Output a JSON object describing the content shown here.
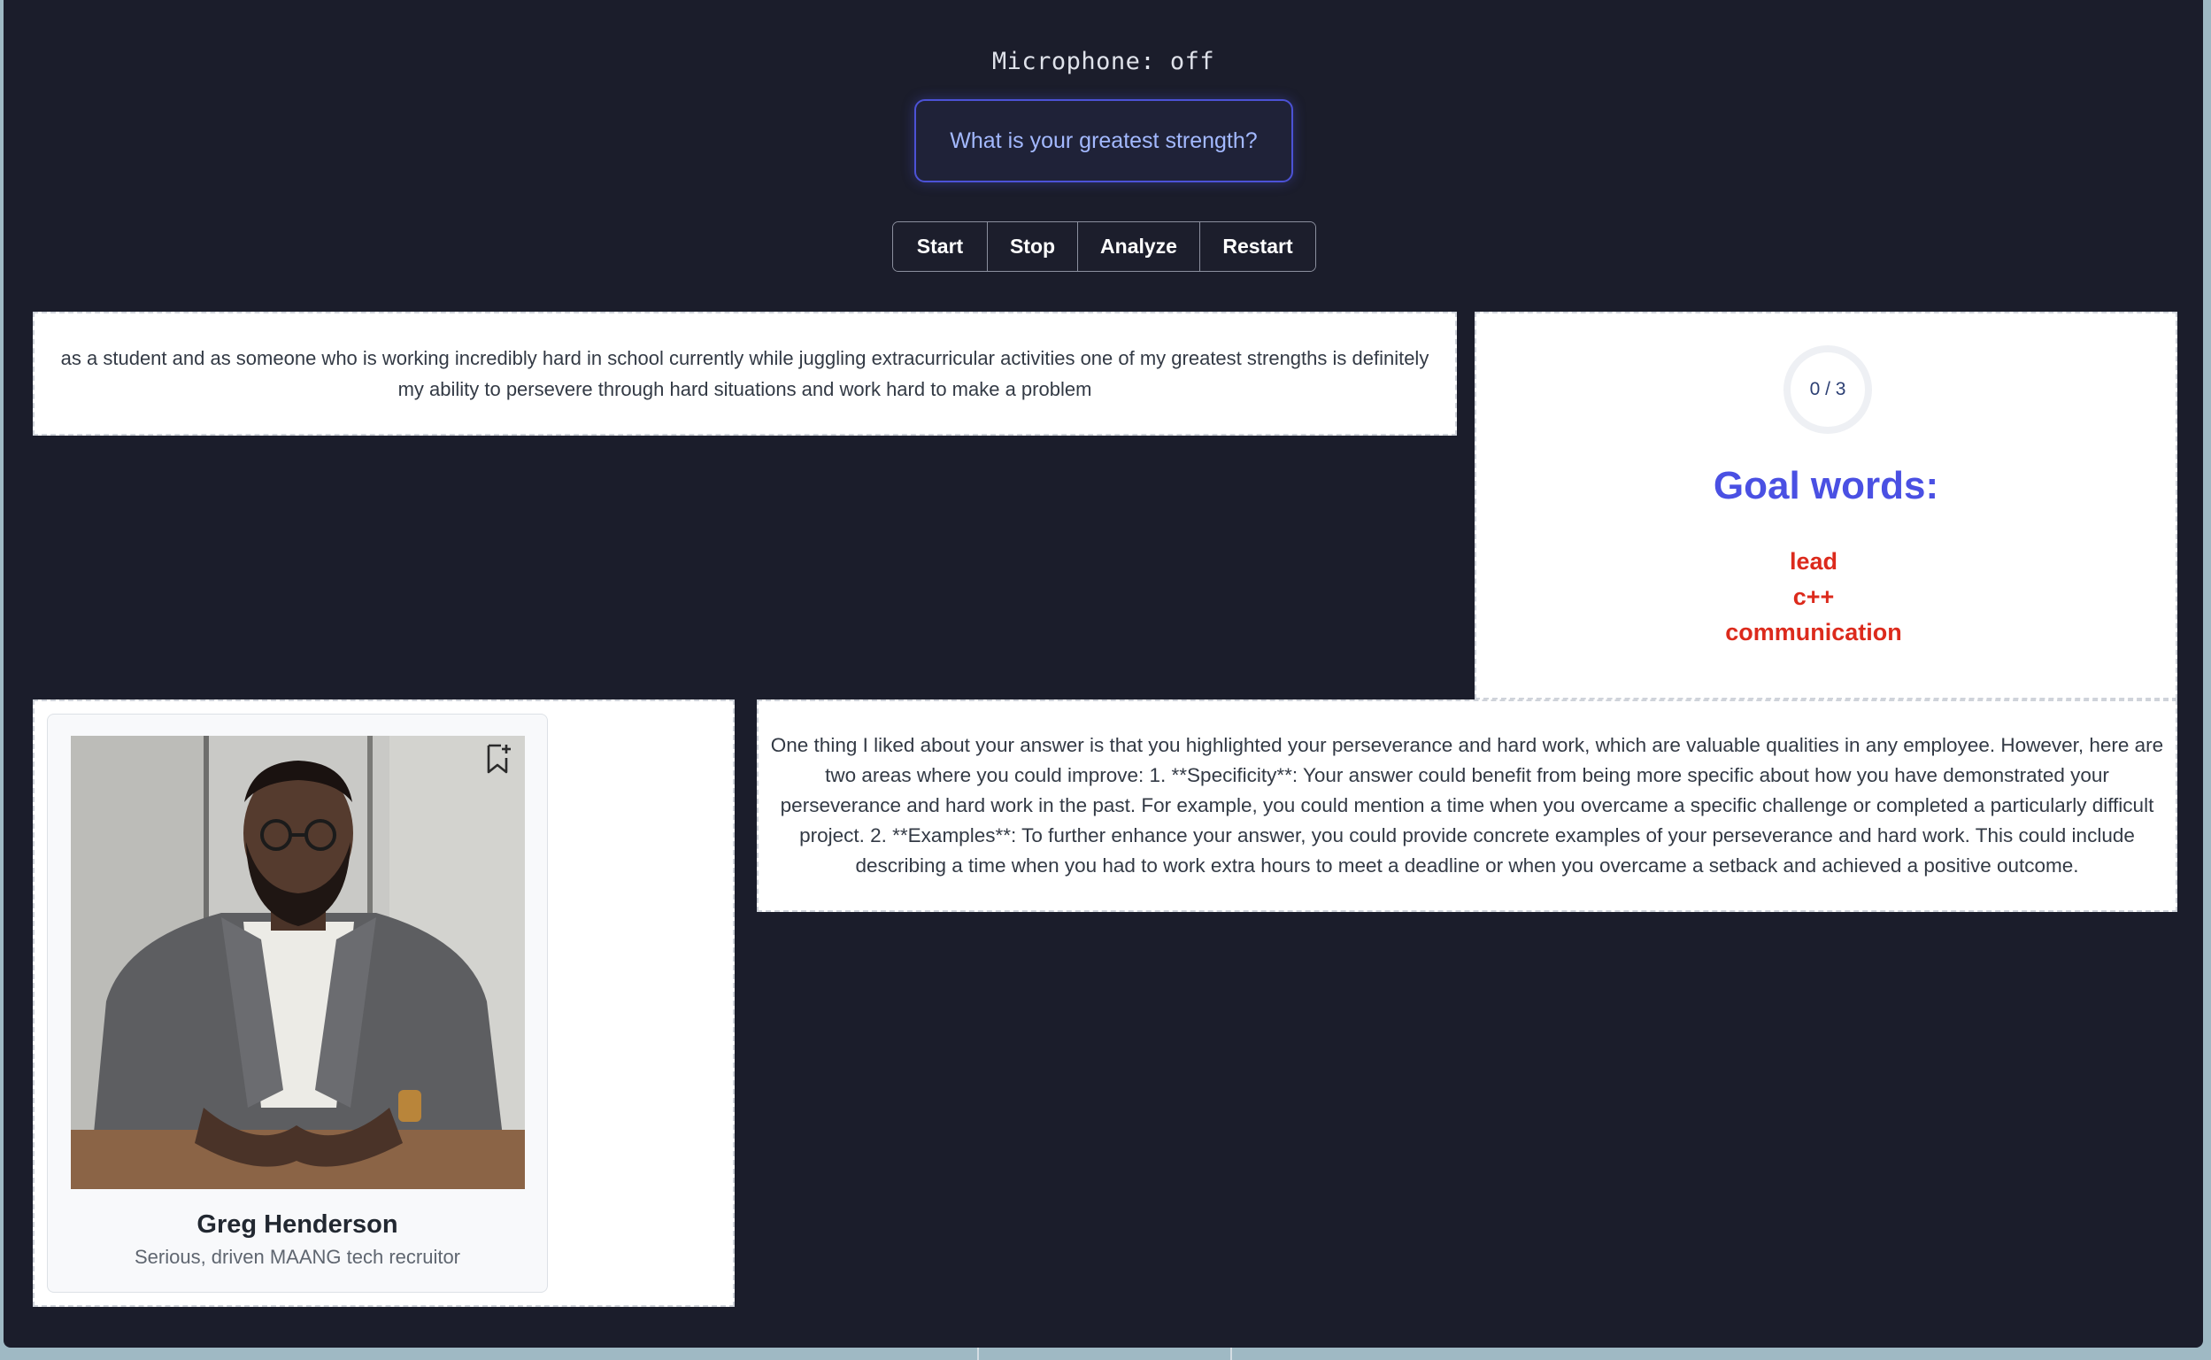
{
  "microphone": {
    "status_text": "Microphone: off"
  },
  "question": {
    "text": "What is your greatest strength?"
  },
  "controls": {
    "start_label": "Start",
    "stop_label": "Stop",
    "analyze_label": "Analyze",
    "restart_label": "Restart"
  },
  "transcript": {
    "text": "as a student and as someone who is working incredibly hard in school currently while juggling extracurricular activities one of my greatest strengths is definitely my ability to persevere through hard situations and work hard to make a problem"
  },
  "goals": {
    "progress_text": "0 / 3",
    "progress_fraction": 0,
    "title": "Goal words:",
    "words": [
      "lead",
      "c++",
      "communication"
    ],
    "accent_color": "#4a50e3",
    "word_color": "#dc2a1c"
  },
  "profile": {
    "name": "Greg Henderson",
    "role": "Serious, driven MAANG tech recruitor",
    "photo_icon": "recruiter-portrait",
    "bookmark_icon": "bookmark-add-icon"
  },
  "feedback": {
    "text": "One thing I liked about your answer is that you highlighted your perseverance and hard work, which are valuable qualities in any employee. However, here are two areas where you could improve: 1. **Specificity**: Your answer could benefit from being more specific about how you have demonstrated your perseverance and hard work in the past. For example, you could mention a time when you overcame a specific challenge or completed a particularly difficult project. 2. **Examples**: To further enhance your answer, you could provide concrete examples of your perseverance and hard work. This could include describing a time when you had to work extra hours to meet a deadline or when you overcame a setback and achieved a positive outcome."
  },
  "theme": {
    "background": "#1b1d2b",
    "panel": "#ffffff"
  }
}
